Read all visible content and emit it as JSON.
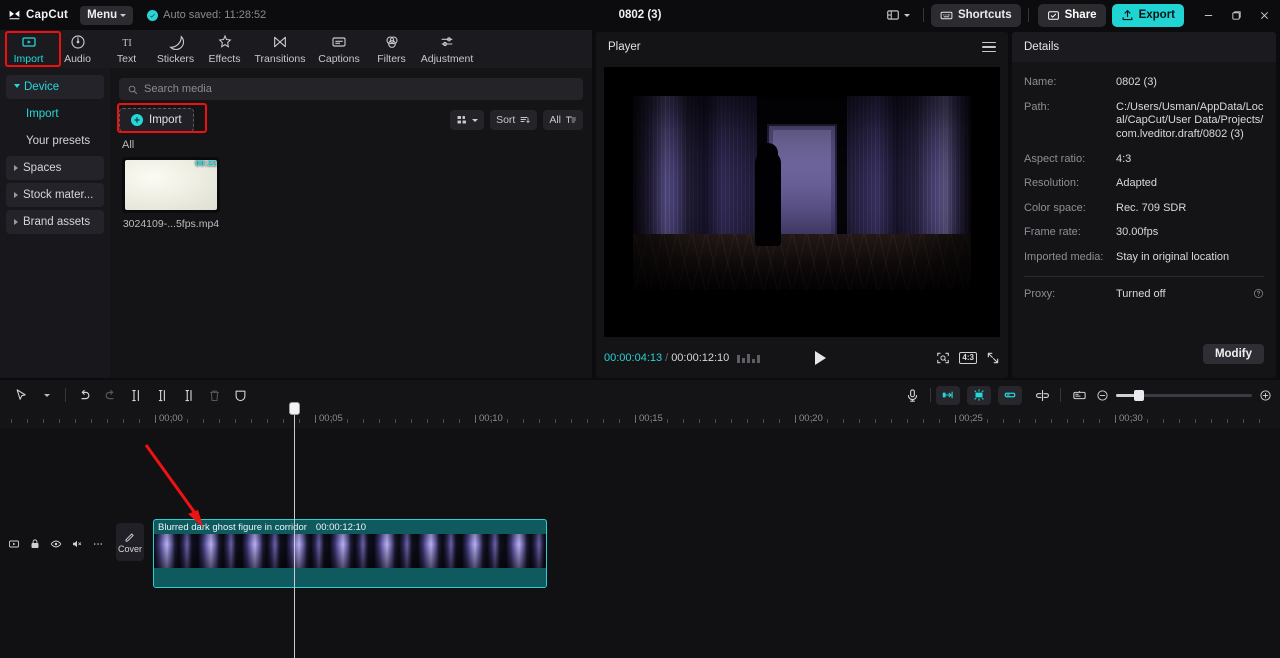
{
  "titlebar": {
    "brand": "CapCut",
    "menu_label": "Menu",
    "autosave": "Auto saved: 11:28:52",
    "project_title": "0802 (3)",
    "shortcuts_label": "Shortcuts",
    "share_label": "Share",
    "export_label": "Export",
    "accent": "#20d4d4"
  },
  "module_tabs": [
    {
      "label": "Import",
      "icon": "import-icon",
      "active": true
    },
    {
      "label": "Audio",
      "icon": "audio-icon",
      "active": false
    },
    {
      "label": "Text",
      "icon": "text-icon",
      "active": false
    },
    {
      "label": "Stickers",
      "icon": "stickers-icon",
      "active": false
    },
    {
      "label": "Effects",
      "icon": "effects-icon",
      "active": false
    },
    {
      "label": "Transitions",
      "icon": "transitions-icon",
      "active": false
    },
    {
      "label": "Captions",
      "icon": "captions-icon",
      "active": false
    },
    {
      "label": "Filters",
      "icon": "filters-icon",
      "active": false
    },
    {
      "label": "Adjustment",
      "icon": "adjustment-icon",
      "active": false
    }
  ],
  "sidebar": {
    "items": [
      {
        "label": "Device",
        "type": "group",
        "expanded": true,
        "active": true
      },
      {
        "label": "Import",
        "type": "sub",
        "active": true
      },
      {
        "label": "Your presets",
        "type": "sub",
        "active": false
      },
      {
        "label": "Spaces",
        "type": "group",
        "expanded": false,
        "active": false
      },
      {
        "label": "Stock mater...",
        "type": "group",
        "expanded": false,
        "active": false
      },
      {
        "label": "Brand assets",
        "type": "group",
        "expanded": false,
        "active": false
      }
    ]
  },
  "media_panel": {
    "search_placeholder": "Search media",
    "import_label": "Import",
    "sort_label": "Sort",
    "filter_label": "All",
    "section_label": "All",
    "items": [
      {
        "name": "3024109-...5fps.mp4",
        "duration": "00:22"
      }
    ]
  },
  "player": {
    "title": "Player",
    "current_time": "00:00:04:13",
    "total_time": "00:00:12:10",
    "ratio_label": "4:3"
  },
  "details": {
    "title": "Details",
    "rows": [
      {
        "key": "Name:",
        "value": "0802 (3)"
      },
      {
        "key": "Path:",
        "value": "C:/Users/Usman/AppData/Local/CapCut/User Data/Projects/com.lveditor.draft/0802 (3)"
      },
      {
        "key": "Aspect ratio:",
        "value": "4:3"
      },
      {
        "key": "Resolution:",
        "value": "Adapted"
      },
      {
        "key": "Color space:",
        "value": "Rec. 709 SDR"
      },
      {
        "key": "Frame rate:",
        "value": "30.00fps"
      },
      {
        "key": "Imported media:",
        "value": "Stay in original location"
      }
    ],
    "proxy": {
      "key": "Proxy:",
      "value": "Turned off"
    },
    "modify_label": "Modify"
  },
  "timeline": {
    "ruler_labels": [
      "00:00",
      "00:05",
      "00:10",
      "00:15",
      "00:20",
      "00:25",
      "00:30"
    ],
    "ruler_positions": [
      155,
      315,
      475,
      635,
      795,
      955,
      1115
    ],
    "clip": {
      "label": "Blurred dark ghost figure in corridor",
      "duration": "00:00:12:10"
    },
    "cover_label": "Cover"
  }
}
